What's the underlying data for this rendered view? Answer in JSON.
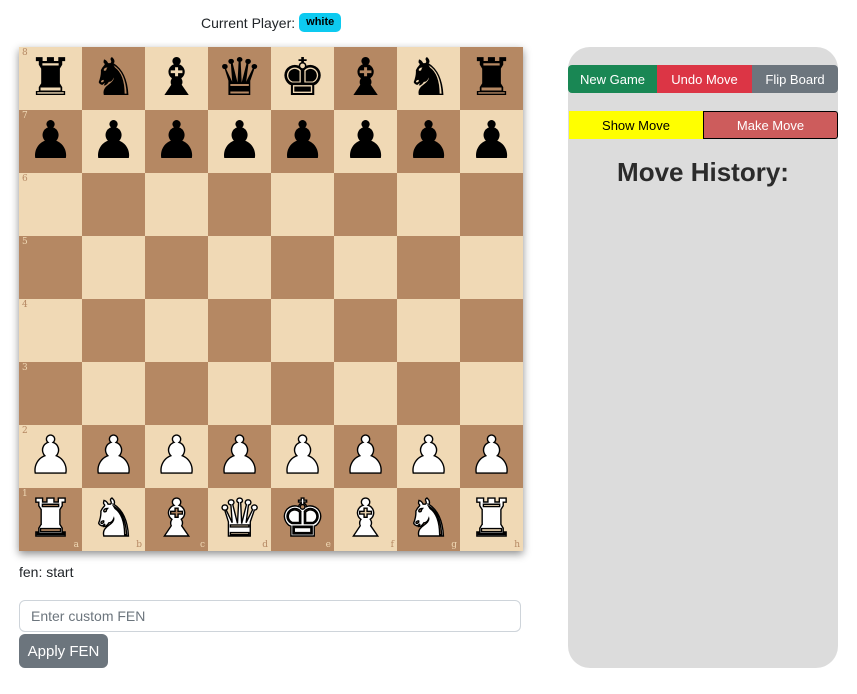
{
  "current_player": {
    "label": "Current Player:",
    "value": "white",
    "badge_color": "#0dcaf0"
  },
  "board": {
    "light_color": "#f0d9b5",
    "dark_color": "#b58863",
    "ranks": [
      "8",
      "7",
      "6",
      "5",
      "4",
      "3",
      "2",
      "1"
    ],
    "files": [
      "a",
      "b",
      "c",
      "d",
      "e",
      "f",
      "g",
      "h"
    ],
    "rows": [
      [
        "r",
        "n",
        "b",
        "q",
        "k",
        "b",
        "n",
        "r"
      ],
      [
        "p",
        "p",
        "p",
        "p",
        "p",
        "p",
        "p",
        "p"
      ],
      [
        "",
        "",
        "",
        "",
        "",
        "",
        "",
        ""
      ],
      [
        "",
        "",
        "",
        "",
        "",
        "",
        "",
        ""
      ],
      [
        "",
        "",
        "",
        "",
        "",
        "",
        "",
        ""
      ],
      [
        "",
        "",
        "",
        "",
        "",
        "",
        "",
        ""
      ],
      [
        "P",
        "P",
        "P",
        "P",
        "P",
        "P",
        "P",
        "P"
      ],
      [
        "R",
        "N",
        "B",
        "Q",
        "K",
        "B",
        "N",
        "R"
      ]
    ]
  },
  "fen": {
    "label": "fen: start",
    "input_placeholder": "Enter custom FEN",
    "input_value": "",
    "apply_label": "Apply FEN"
  },
  "controls": {
    "new_game": "New Game",
    "undo_move": "Undo Move",
    "flip_board": "Flip Board",
    "show_move": "Show Move",
    "make_move": "Make Move"
  },
  "history": {
    "title": "Move History:",
    "moves": []
  }
}
